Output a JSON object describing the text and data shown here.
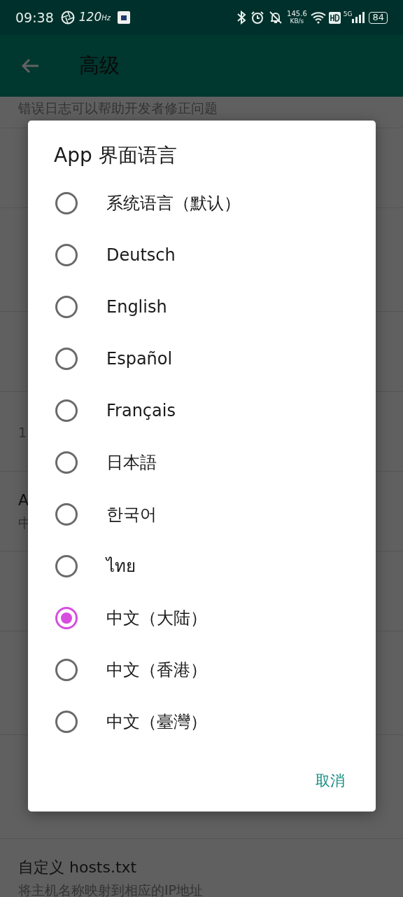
{
  "status_bar": {
    "time": "09:38",
    "refresh_rate": "120",
    "refresh_unit": "Hz",
    "speed": "145.6",
    "speed_unit": "KB/s",
    "network": "5G",
    "battery": "84"
  },
  "app_bar": {
    "title": "高级"
  },
  "settings": [
    {
      "lines": [
        {
          "kind": "summary",
          "text": "错误日志可以帮助开发者修正问题"
        }
      ]
    },
    {
      "lines": [
        {
          "kind": "summary",
          "text": "1"
        }
      ]
    },
    {
      "lines": [
        {
          "kind": "title",
          "text": "A"
        },
        {
          "kind": "summary",
          "text": "中"
        }
      ]
    },
    {
      "lines": [
        {
          "kind": "title",
          "text": "自定义 hosts.txt"
        },
        {
          "kind": "summary",
          "text": "将主机名称映射到相应的IP地址"
        }
      ]
    }
  ],
  "dialog": {
    "title": "App 界面语言",
    "options": [
      {
        "label": "系统语言（默认）",
        "selected": false
      },
      {
        "label": "Deutsch",
        "selected": false
      },
      {
        "label": "English",
        "selected": false
      },
      {
        "label": "Español",
        "selected": false
      },
      {
        "label": "Français",
        "selected": false
      },
      {
        "label": "日本語",
        "selected": false
      },
      {
        "label": "한국어",
        "selected": false
      },
      {
        "label": "ไทย",
        "selected": false
      },
      {
        "label": "中文（大陆）",
        "selected": true
      },
      {
        "label": "中文（香港）",
        "selected": false
      },
      {
        "label": "中文（臺灣）",
        "selected": false
      }
    ],
    "cancel": "取消"
  }
}
